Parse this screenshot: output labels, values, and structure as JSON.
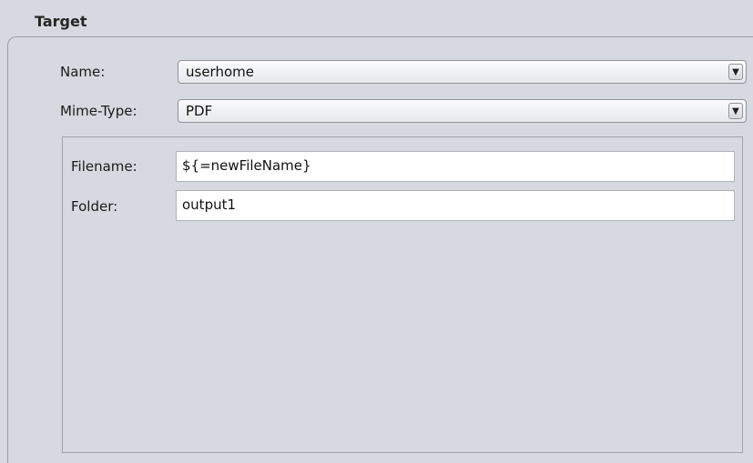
{
  "group": {
    "title": "Target"
  },
  "form": {
    "name_label": "Name:",
    "name_value": "userhome",
    "mime_label": "Mime-Type:",
    "mime_value": "PDF",
    "arrow_glyph": "▼"
  },
  "details": {
    "filename_label": "Filename:",
    "filename_value": "${=newFileName}",
    "folder_label": "Folder:",
    "folder_value": "output1"
  }
}
